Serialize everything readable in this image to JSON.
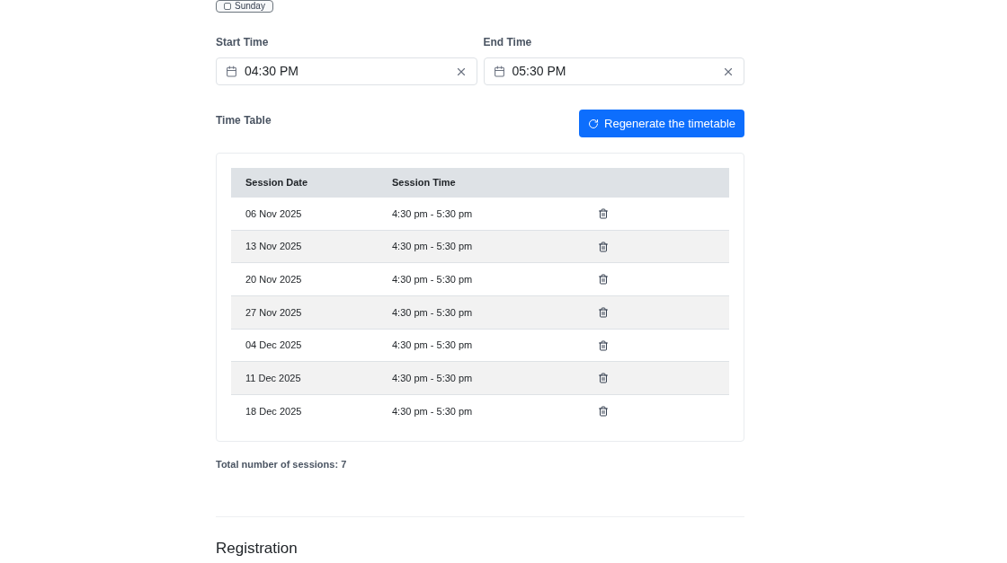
{
  "day_chip": {
    "label": "Sunday",
    "checked": false
  },
  "start_time": {
    "label": "Start Time",
    "value": "04:30 PM"
  },
  "end_time": {
    "label": "End Time",
    "value": "05:30 PM"
  },
  "timetable": {
    "title": "Time Table",
    "regenerate_button": "Regenerate the timetable",
    "columns": [
      "Session Date",
      "Session Time"
    ],
    "rows": [
      {
        "date": "06 Nov 2025",
        "time": "4:30 pm - 5:30 pm"
      },
      {
        "date": "13 Nov 2025",
        "time": "4:30 pm - 5:30 pm"
      },
      {
        "date": "20 Nov 2025",
        "time": "4:30 pm - 5:30 pm"
      },
      {
        "date": "27 Nov 2025",
        "time": "4:30 pm - 5:30 pm"
      },
      {
        "date": "04 Dec 2025",
        "time": "4:30 pm - 5:30 pm"
      },
      {
        "date": "11 Dec 2025",
        "time": "4:30 pm - 5:30 pm"
      },
      {
        "date": "18 Dec 2025",
        "time": "4:30 pm - 5:30 pm"
      }
    ]
  },
  "total_sessions": "Total number of sessions: 7",
  "next_section_title": "Registration"
}
